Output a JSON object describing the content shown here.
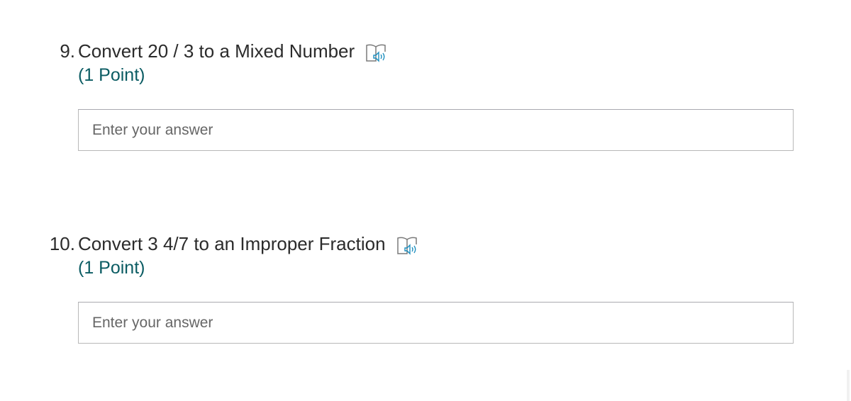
{
  "questions": [
    {
      "number": "9.",
      "text": "Convert 20 / 3 to a Mixed Number",
      "points": "(1 Point)",
      "answer_placeholder": "Enter your answer",
      "answer_value": ""
    },
    {
      "number": "10.",
      "text": "Convert 3 4/7 to an Improper Fraction",
      "points": "(1 Point)",
      "answer_placeholder": "Enter your answer",
      "answer_value": ""
    }
  ],
  "icons": {
    "reader": "immersive-reader-icon"
  },
  "colors": {
    "points_text": "#0b5c63",
    "reader_icon_accent": "#1e8fbf",
    "reader_icon_outline": "#7a7a7a",
    "box_border": "#b8b8b8"
  }
}
